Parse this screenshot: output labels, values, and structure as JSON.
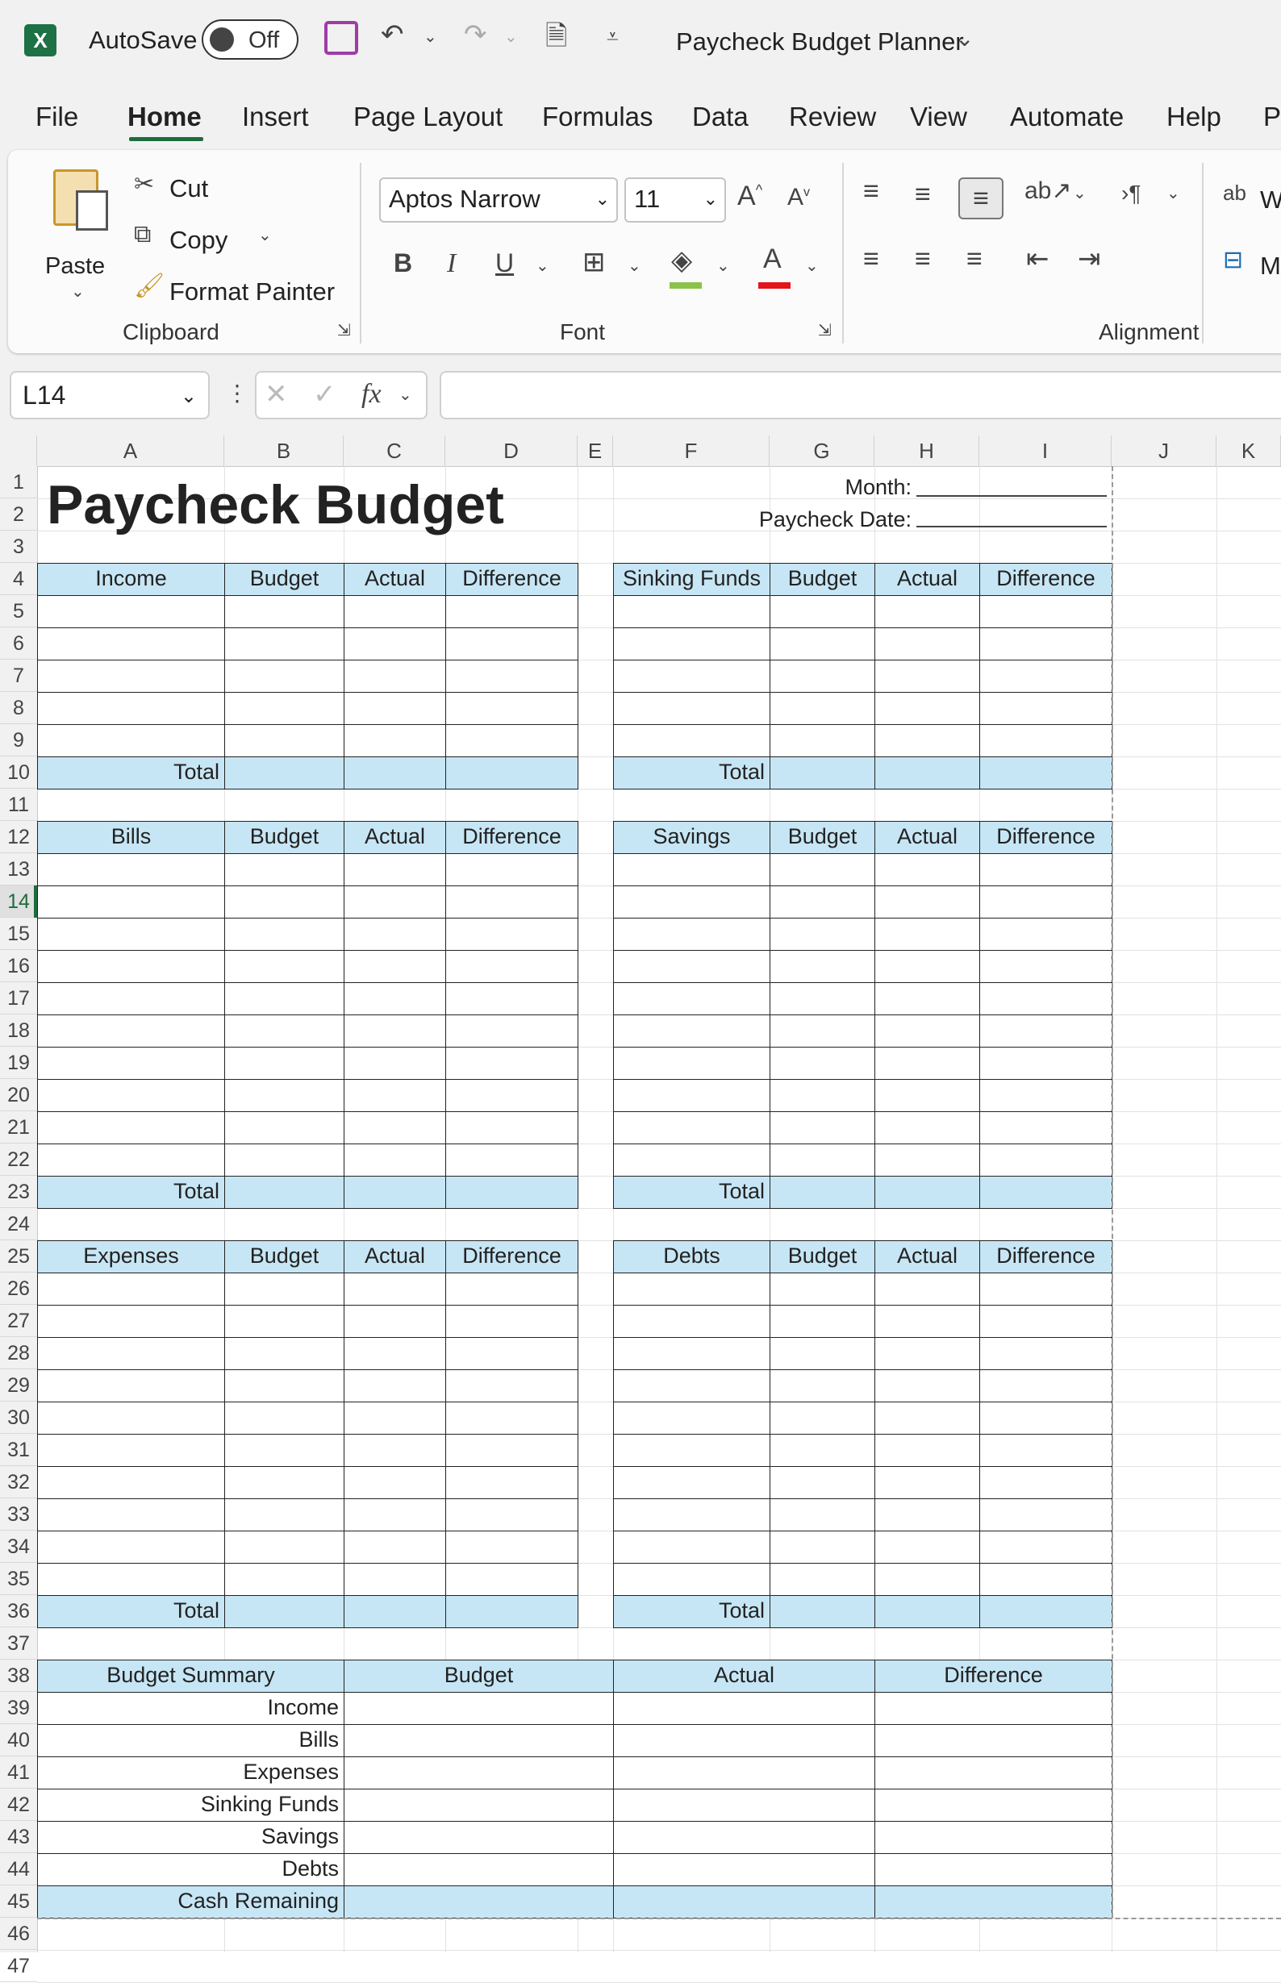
{
  "titlebar": {
    "autosave_label": "AutoSave",
    "autosave_state": "Off",
    "doc_title": "Paycheck Budget Planner"
  },
  "tabs": [
    "File",
    "Home",
    "Insert",
    "Page Layout",
    "Formulas",
    "Data",
    "Review",
    "View",
    "Automate",
    "Help",
    "P"
  ],
  "active_tab": "Home",
  "ribbon": {
    "clipboard": {
      "paste": "Paste",
      "cut": "Cut",
      "copy": "Copy",
      "format_painter": "Format Painter",
      "group_label": "Clipboard"
    },
    "font": {
      "font_name": "Aptos Narrow",
      "font_size": "11",
      "group_label": "Font"
    },
    "alignment": {
      "group_label": "Alignment",
      "wrap_partial": "ab",
      "wrap_letter": "W",
      "merge_letter": "M"
    }
  },
  "formula_bar": {
    "name_box": "L14",
    "fx": "fx",
    "value": ""
  },
  "columns": [
    "A",
    "B",
    "C",
    "D",
    "E",
    "F",
    "G",
    "H",
    "I",
    "J",
    "K"
  ],
  "rows": [
    "1",
    "2",
    "3",
    "4",
    "5",
    "6",
    "7",
    "8",
    "9",
    "10",
    "11",
    "12",
    "13",
    "14",
    "15",
    "16",
    "17",
    "18",
    "19",
    "20",
    "21",
    "22",
    "23",
    "24",
    "25",
    "26",
    "27",
    "28",
    "29",
    "30",
    "31",
    "32",
    "33",
    "34",
    "35",
    "36",
    "37",
    "38",
    "39",
    "40",
    "41",
    "42",
    "43",
    "44",
    "45",
    "46",
    "47"
  ],
  "sheet": {
    "title": "Paycheck Budget",
    "month_label": "Month:",
    "paycheck_date_label": "Paycheck Date:",
    "left_tables": [
      "Income",
      "Bills",
      "Expenses"
    ],
    "right_tables": [
      "Sinking Funds",
      "Savings",
      "Debts"
    ],
    "col_budget": "Budget",
    "col_actual": "Actual",
    "col_difference": "Difference",
    "total_label": "Total",
    "summary": {
      "title": "Budget Summary",
      "col_budget": "Budget",
      "col_actual": "Actual",
      "col_difference": "Difference",
      "rows": [
        "Income",
        "Bills",
        "Expenses",
        "Sinking Funds",
        "Savings",
        "Debts"
      ],
      "cash_remaining": "Cash Remaining"
    }
  }
}
